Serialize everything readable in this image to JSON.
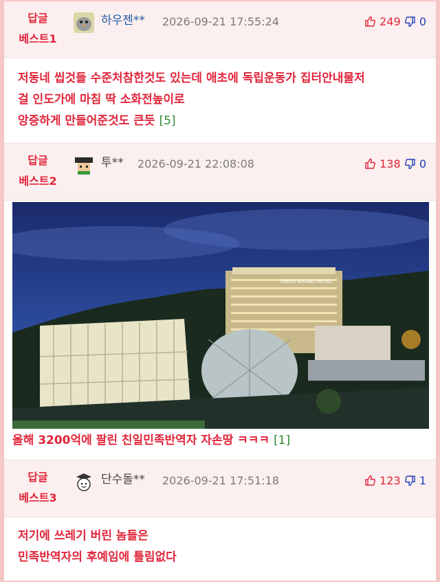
{
  "comments": [
    {
      "rank_line1": "답글",
      "rank_line2": "베스트1",
      "nickname": "하우젠**",
      "date": "2026-09-21 17:55:24",
      "up": "249",
      "down": "0",
      "lines": [
        "저동네 씹것들 수준처참한것도 있는데 애초에 독립운동가 집터안내물저",
        "걸 인도가에 마침 딱 소화전높이로",
        "앙증하게 만들어준것도 큰듯"
      ],
      "reply_count": "[5]"
    },
    {
      "rank_line1": "답글",
      "rank_line2": "베스트2",
      "nickname": "투**",
      "date": "2026-09-21 22:08:08",
      "up": "138",
      "down": "0",
      "caption": "올해 3200억에 팔린 친일민족반역자 자손땅 ㅋㅋㅋ",
      "reply_count": "[1]",
      "photo_sign": "SWISS GRAND HOTEL"
    },
    {
      "rank_line1": "답글",
      "rank_line2": "베스트3",
      "nickname": "단수돌**",
      "date": "2026-09-21 17:51:18",
      "up": "123",
      "down": "1",
      "lines": [
        "저기에 쓰레기 버린 놈들은",
        "민족반역자의 후예임에 틀림없다"
      ]
    }
  ],
  "colors": {
    "accent": "#e0253a",
    "down": "#1f3fb8",
    "reply": "#2e8b2e",
    "header_bg": "#fcefef",
    "frame": "#f6c7c7"
  },
  "icons": {
    "up": "thumbs-up-icon",
    "down": "thumbs-down-icon"
  }
}
